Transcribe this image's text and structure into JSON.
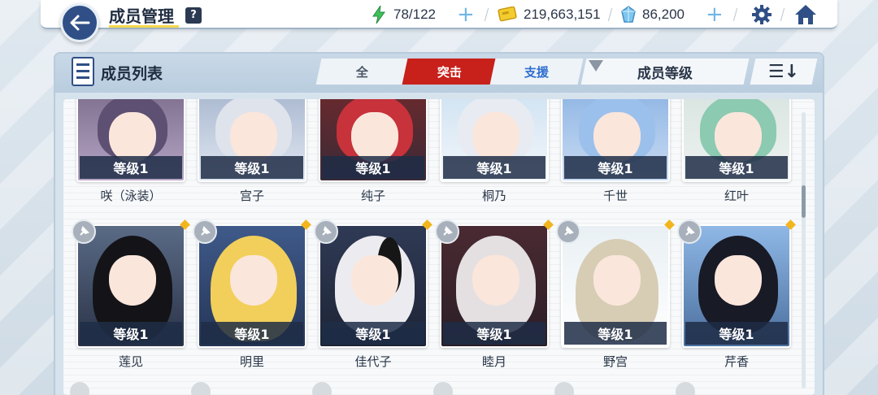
{
  "header": {
    "title": "成员管理",
    "help_label": "?",
    "stamina": "78/122",
    "credits": "219,663,151",
    "gems": "86,200",
    "plus_label": "+"
  },
  "panel": {
    "title": "成员列表",
    "filters": [
      "全",
      "突击",
      "支援"
    ],
    "active_filter": "突击",
    "sort_label": "成员等级"
  },
  "row1": [
    {
      "name": "咲（泳装）",
      "level": "等级1"
    },
    {
      "name": "宫子",
      "level": "等级1"
    },
    {
      "name": "纯子",
      "level": "等级1"
    },
    {
      "name": "桐乃",
      "level": "等级1"
    },
    {
      "name": "千世",
      "level": "等级1"
    },
    {
      "name": "红叶",
      "level": "等级1"
    }
  ],
  "row2": [
    {
      "name": "莲见",
      "level": "等级1"
    },
    {
      "name": "明里",
      "level": "等级1"
    },
    {
      "name": "佳代子",
      "level": "等级1"
    },
    {
      "name": "睦月",
      "level": "等级1"
    },
    {
      "name": "野宫",
      "level": "等级1"
    },
    {
      "name": "芹香",
      "level": "等级1"
    }
  ],
  "colors": {
    "accent_red": "#c8201a",
    "support_blue": "#2e6fd0",
    "nav_blue": "#2f4f86",
    "level_bar": "#1e2d46"
  }
}
